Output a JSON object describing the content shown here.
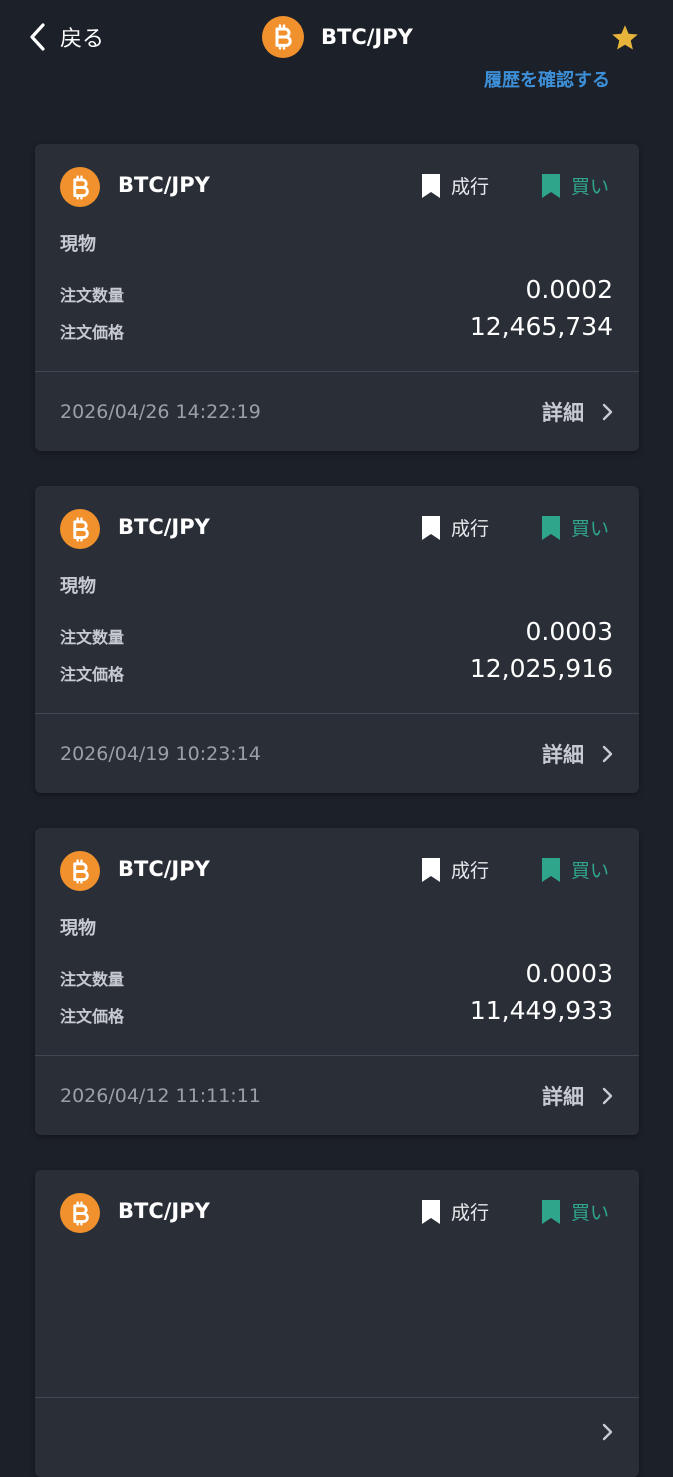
{
  "header": {
    "back_label": "戻る",
    "title": "BTC/JPY",
    "history_link": "履歴を確認する"
  },
  "colors": {
    "background": "#1c2028",
    "card": "#2a2f37",
    "btc_orange": "#f0912e",
    "buy_green": "#2fa58b",
    "link_blue": "#3d8fd8",
    "star_gold": "#e6b33b"
  },
  "icons": {
    "back": "chevron-left-icon",
    "coin": "bitcoin-icon",
    "favorite": "star-icon",
    "order_type": "bookmark-icon",
    "side": "bookmark-icon",
    "detail": "chevron-right-icon"
  },
  "orders": [
    {
      "pair": "BTC/JPY",
      "order_type": "成行",
      "side": "買い",
      "category": "現物",
      "qty_label": "注文数量",
      "qty_value": "0.0002",
      "price_label": "注文価格",
      "price_value": "12,465,734",
      "timestamp": "2026/04/26 14:22:19",
      "detail_label": "詳細"
    },
    {
      "pair": "BTC/JPY",
      "order_type": "成行",
      "side": "買い",
      "category": "現物",
      "qty_label": "注文数量",
      "qty_value": "0.0003",
      "price_label": "注文価格",
      "price_value": "12,025,916",
      "timestamp": "2026/04/19 10:23:14",
      "detail_label": "詳細"
    },
    {
      "pair": "BTC/JPY",
      "order_type": "成行",
      "side": "買い",
      "category": "現物",
      "qty_label": "注文数量",
      "qty_value": "0.0003",
      "price_label": "注文価格",
      "price_value": "11,449,933",
      "timestamp": "2026/04/12 11:11:11",
      "detail_label": "詳細"
    },
    {
      "pair": "BTC/JPY",
      "order_type": "成行",
      "side": "買い",
      "category": "",
      "qty_label": "",
      "qty_value": "",
      "price_label": "",
      "price_value": "",
      "timestamp": "",
      "detail_label": ""
    }
  ]
}
